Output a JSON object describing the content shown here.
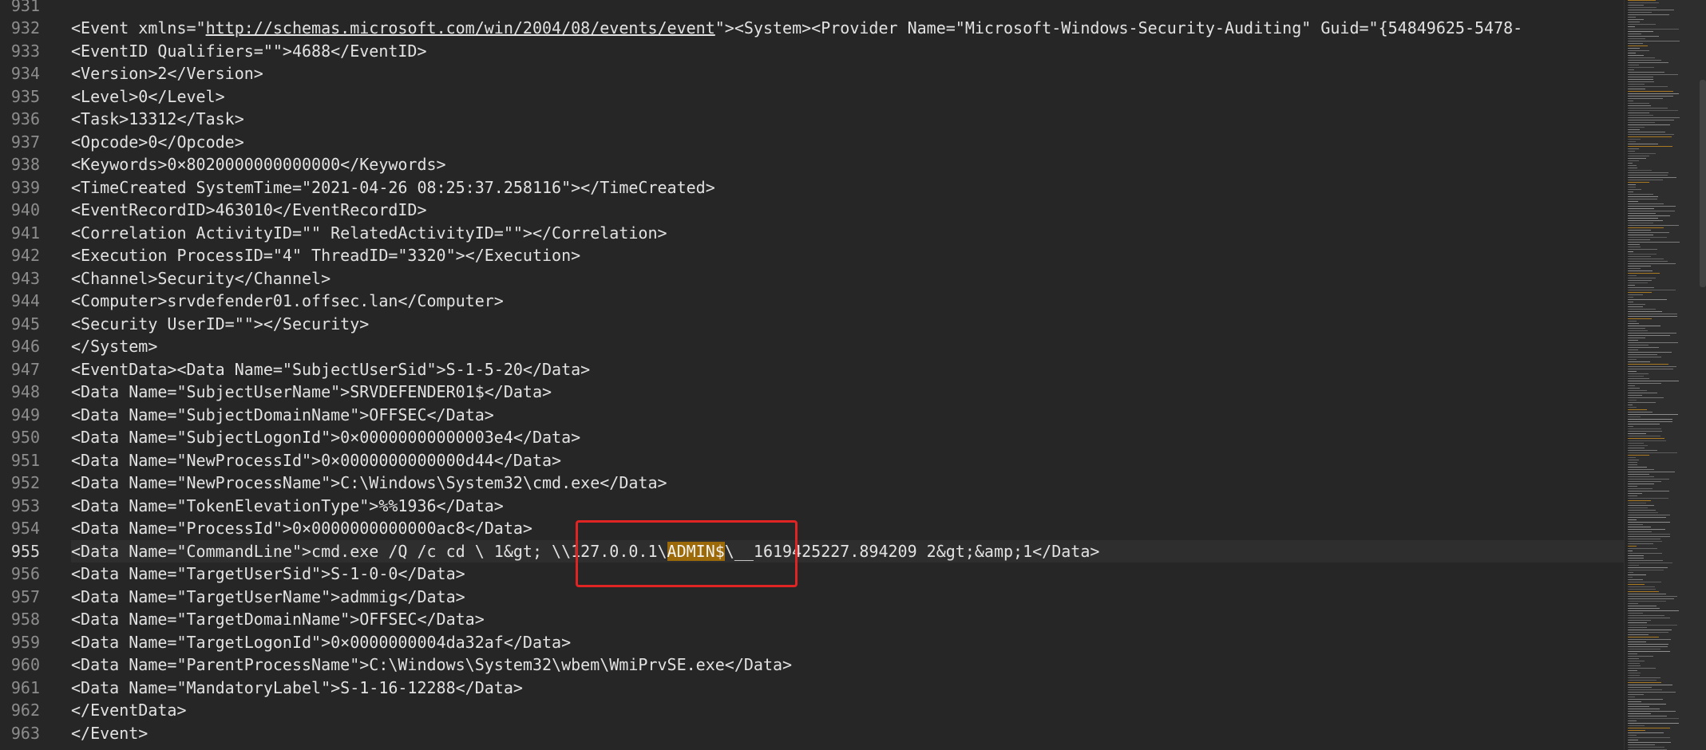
{
  "colors": {
    "background": "#262626",
    "text": "#e2e2e2",
    "line_number": "#8d8d8d",
    "current_line_bg": "#2e2e2e",
    "search_highlight": "#9c6a08",
    "annotation_box": "#e02323"
  },
  "editor": {
    "current_line": "955",
    "lines": [
      {
        "num": "931",
        "segments": [
          {
            "text": ""
          }
        ]
      },
      {
        "num": "932",
        "segments": [
          {
            "text": "<Event xmlns=\""
          },
          {
            "text": "http://schemas.microsoft.com/win/2004/08/events/event",
            "style": "url"
          },
          {
            "text": "\"><System><Provider Name=\"Microsoft-Windows-Security-Auditing\" Guid=\"{54849625-5478-"
          }
        ]
      },
      {
        "num": "933",
        "segments": [
          {
            "text": "<EventID Qualifiers=\"\">4688</EventID>"
          }
        ]
      },
      {
        "num": "934",
        "segments": [
          {
            "text": "<Version>2</Version>"
          }
        ]
      },
      {
        "num": "935",
        "segments": [
          {
            "text": "<Level>0</Level>"
          }
        ]
      },
      {
        "num": "936",
        "segments": [
          {
            "text": "<Task>13312</Task>"
          }
        ]
      },
      {
        "num": "937",
        "segments": [
          {
            "text": "<Opcode>0</Opcode>"
          }
        ]
      },
      {
        "num": "938",
        "segments": [
          {
            "text": "<Keywords>0×8020000000000000</Keywords>"
          }
        ]
      },
      {
        "num": "939",
        "segments": [
          {
            "text": "<TimeCreated SystemTime=\"2021-04-26 08:25:37.258116\"></TimeCreated>"
          }
        ]
      },
      {
        "num": "940",
        "segments": [
          {
            "text": "<EventRecordID>463010</EventRecordID>"
          }
        ]
      },
      {
        "num": "941",
        "segments": [
          {
            "text": "<Correlation ActivityID=\"\" RelatedActivityID=\"\"></Correlation>"
          }
        ]
      },
      {
        "num": "942",
        "segments": [
          {
            "text": "<Execution ProcessID=\"4\" ThreadID=\"3320\"></Execution>"
          }
        ]
      },
      {
        "num": "943",
        "segments": [
          {
            "text": "<Channel>Security</Channel>"
          }
        ]
      },
      {
        "num": "944",
        "segments": [
          {
            "text": "<Computer>srvdefender01.offsec.lan</Computer>"
          }
        ]
      },
      {
        "num": "945",
        "segments": [
          {
            "text": "<Security UserID=\"\"></Security>"
          }
        ]
      },
      {
        "num": "946",
        "segments": [
          {
            "text": "</System>"
          }
        ]
      },
      {
        "num": "947",
        "segments": [
          {
            "text": "<EventData><Data Name=\"SubjectUserSid\">S-1-5-20</Data>"
          }
        ]
      },
      {
        "num": "948",
        "segments": [
          {
            "text": "<Data Name=\"SubjectUserName\">SRVDEFENDER01$</Data>"
          }
        ]
      },
      {
        "num": "949",
        "segments": [
          {
            "text": "<Data Name=\"SubjectDomainName\">OFFSEC</Data>"
          }
        ]
      },
      {
        "num": "950",
        "segments": [
          {
            "text": "<Data Name=\"SubjectLogonId\">0×00000000000003e4</Data>"
          }
        ]
      },
      {
        "num": "951",
        "segments": [
          {
            "text": "<Data Name=\"NewProcessId\">0×0000000000000d44</Data>"
          }
        ]
      },
      {
        "num": "952",
        "segments": [
          {
            "text": "<Data Name=\"NewProcessName\">C:\\Windows\\System32\\cmd.exe</Data>"
          }
        ]
      },
      {
        "num": "953",
        "segments": [
          {
            "text": "<Data Name=\"TokenElevationType\">%%1936</Data>"
          }
        ]
      },
      {
        "num": "954",
        "segments": [
          {
            "text": "<Data Name=\"ProcessId\">0×0000000000000ac8</Data>"
          }
        ]
      },
      {
        "num": "955",
        "segments": [
          {
            "text": "<Data Name=\"CommandLine\">cmd.exe /Q /c cd \\ 1&gt; \\\\127.0.0.1\\"
          },
          {
            "text": "ADMIN$",
            "style": "hl"
          },
          {
            "text": "\\__1619425227.894209 2&gt;&amp;1</Data>"
          }
        ]
      },
      {
        "num": "956",
        "segments": [
          {
            "text": "<Data Name=\"TargetUserSid\">S-1-0-0</Data>"
          }
        ]
      },
      {
        "num": "957",
        "segments": [
          {
            "text": "<Data Name=\"TargetUserName\">admmig</Data>"
          }
        ]
      },
      {
        "num": "958",
        "segments": [
          {
            "text": "<Data Name=\"TargetDomainName\">OFFSEC</Data>"
          }
        ]
      },
      {
        "num": "959",
        "segments": [
          {
            "text": "<Data Name=\"TargetLogonId\">0×0000000004da32af</Data>"
          }
        ]
      },
      {
        "num": "960",
        "segments": [
          {
            "text": "<Data Name=\"ParentProcessName\">C:\\Windows\\System32\\wbem\\WmiPrvSE.exe</Data>"
          }
        ]
      },
      {
        "num": "961",
        "segments": [
          {
            "text": "<Data Name=\"MandatoryLabel\">S-1-16-12288</Data>"
          }
        ]
      },
      {
        "num": "962",
        "segments": [
          {
            "text": "</EventData>"
          }
        ]
      },
      {
        "num": "963",
        "segments": [
          {
            "text": "</Event>"
          }
        ]
      }
    ]
  }
}
